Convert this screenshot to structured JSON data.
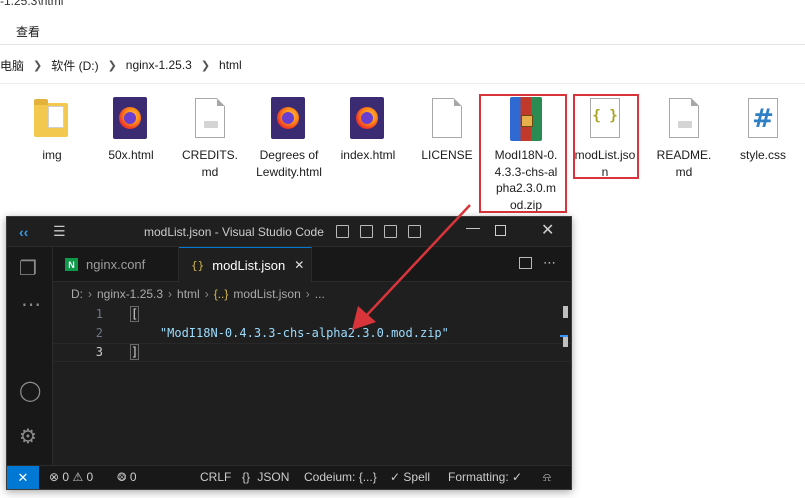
{
  "explorer": {
    "window_title": "-1.25.3\\html",
    "menu": {
      "view": "查看"
    },
    "breadcrumb": [
      "电脑",
      "软件 (D:)",
      "nginx-1.25.3",
      "html"
    ],
    "files": [
      {
        "name": "img",
        "icon": "folder-icon"
      },
      {
        "name": "50x.html",
        "icon": "firefox-html-icon"
      },
      {
        "name": "CREDITS.md",
        "icon": "document-icon"
      },
      {
        "name": "Degrees of Lewdity.html",
        "icon": "firefox-html-icon"
      },
      {
        "name": "index.html",
        "icon": "firefox-html-icon"
      },
      {
        "name": "LICENSE",
        "icon": "document-icon"
      },
      {
        "name": "ModI18N-0.4.3.3-chs-alpha2.3.0.mod.zip",
        "icon": "archive-icon"
      },
      {
        "name": "modList.json",
        "icon": "json-file-icon"
      },
      {
        "name": "README.md",
        "icon": "document-icon"
      },
      {
        "name": "style.css",
        "icon": "css-file-icon"
      }
    ],
    "highlight_color": "#d9343a"
  },
  "vscode": {
    "title": "modList.json - Visual Studio Code",
    "tabs": [
      {
        "label": "nginx.conf",
        "active": false
      },
      {
        "label": "modList.json",
        "active": true
      }
    ],
    "breadcrumb": [
      "D:",
      "nginx-1.25.3",
      "html",
      "{..}",
      "modList.json",
      "..."
    ],
    "editor": {
      "line_numbers": [
        "1",
        "2",
        "3"
      ],
      "lines": [
        "[",
        "    \"ModI18N-0.4.3.3-chs-alpha2.3.0.mod.zip\"",
        "]"
      ]
    },
    "status": {
      "remote_icon": "remote-icon",
      "errors": "0",
      "warnings": "0",
      "ports": "0",
      "eol": "CRLF",
      "language": "JSON",
      "codeium": "Codeium: {...}",
      "spell": "Spell",
      "formatting": "Formatting:",
      "formatting_icon": "check-icon"
    },
    "accent": "#0078d4"
  }
}
